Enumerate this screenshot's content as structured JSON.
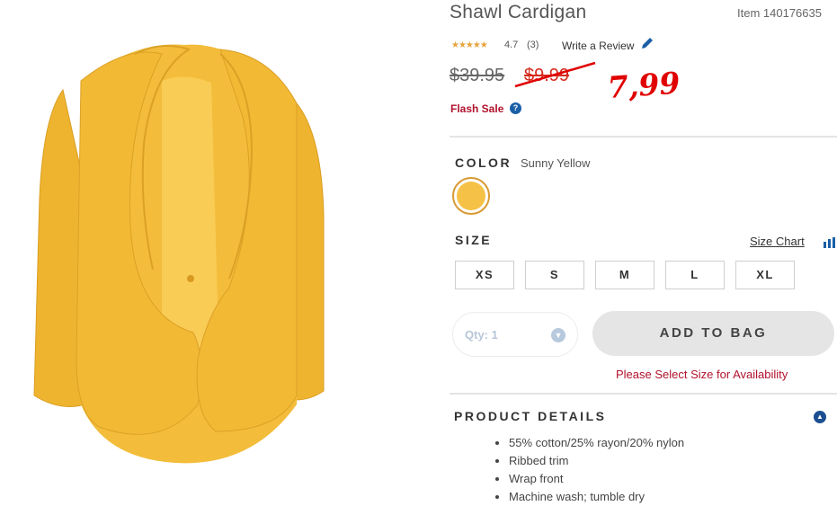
{
  "product": {
    "title": "Shawl Cardigan",
    "item_number": "Item 140176635",
    "image_icon": "yellow-shawl-cardigan"
  },
  "reviews": {
    "stars_glyph": "★★★★★",
    "rating": "4.7",
    "count": "(3)",
    "write_review": "Write a Review"
  },
  "price": {
    "original": "$39.95",
    "sale": "$9.99",
    "handwritten_price": "7,99",
    "flash_sale": "Flash Sale",
    "help_glyph": "?"
  },
  "color": {
    "label": "COLOR",
    "value": "Sunny Yellow",
    "swatch_color": "#f5c247"
  },
  "size": {
    "label": "SIZE",
    "size_chart": "Size Chart",
    "options": [
      "XS",
      "S",
      "M",
      "L",
      "XL"
    ]
  },
  "purchase": {
    "qty_placeholder": "Qty: 1",
    "add_to_bag": "ADD TO BAG",
    "availability": "Please Select Size for Availability"
  },
  "details": {
    "label": "PRODUCT DETAILS",
    "items": [
      "55% cotton/25% rayon/20% nylon",
      "Ribbed trim",
      "Wrap front",
      "Machine wash; tumble dry"
    ]
  },
  "colors": {
    "accent_red": "#b1122c",
    "link_blue": "#1b5fa7",
    "handwritten_red": "#e00000"
  }
}
